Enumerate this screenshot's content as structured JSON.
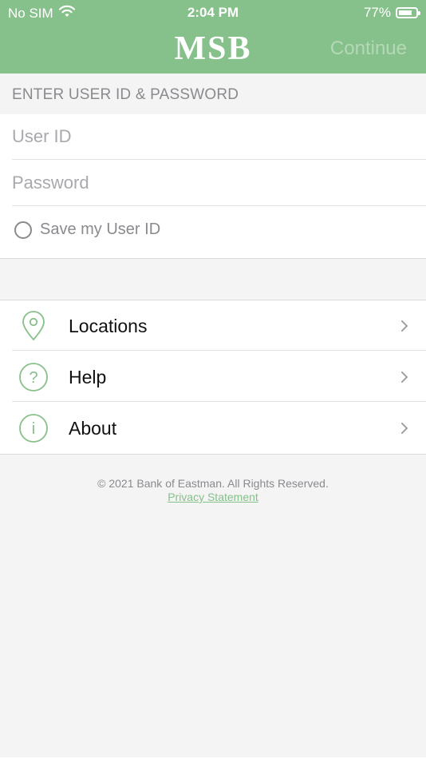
{
  "status_bar": {
    "carrier": "No SIM",
    "time": "2:04 PM",
    "battery": "77%"
  },
  "header": {
    "logo_text": "MSB",
    "continue_label": "Continue",
    "background_color": "#86c08a"
  },
  "login": {
    "section_title": "ENTER USER ID & PASSWORD",
    "user_id_placeholder": "User ID",
    "password_placeholder": "Password",
    "save_user_id_label": "Save my User ID",
    "save_user_id_checked": false
  },
  "menu": {
    "items": [
      {
        "label": "Locations",
        "icon": "map-pin-icon"
      },
      {
        "label": "Help",
        "icon": "question-circle-icon"
      },
      {
        "label": "About",
        "icon": "info-circle-icon"
      }
    ]
  },
  "footer": {
    "copyright": "© 2021 Bank of Eastman. All Rights Reserved.",
    "privacy_link": "Privacy Statement"
  },
  "colors": {
    "accent": "#86c08a",
    "muted_text": "#8a8a8f"
  }
}
